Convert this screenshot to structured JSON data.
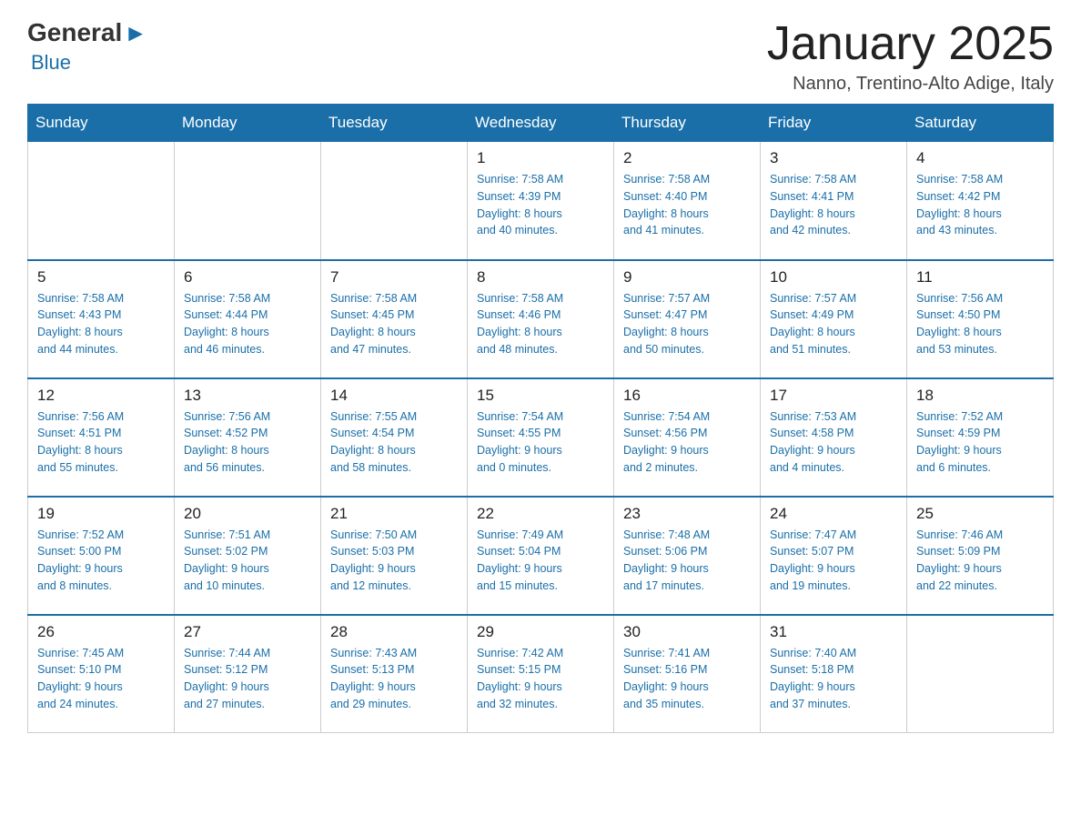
{
  "logo": {
    "general": "General",
    "blue": "Blue",
    "arrow": "▶"
  },
  "title": "January 2025",
  "location": "Nanno, Trentino-Alto Adige, Italy",
  "days_of_week": [
    "Sunday",
    "Monday",
    "Tuesday",
    "Wednesday",
    "Thursday",
    "Friday",
    "Saturday"
  ],
  "weeks": [
    [
      {
        "day": "",
        "info": ""
      },
      {
        "day": "",
        "info": ""
      },
      {
        "day": "",
        "info": ""
      },
      {
        "day": "1",
        "info": "Sunrise: 7:58 AM\nSunset: 4:39 PM\nDaylight: 8 hours\nand 40 minutes."
      },
      {
        "day": "2",
        "info": "Sunrise: 7:58 AM\nSunset: 4:40 PM\nDaylight: 8 hours\nand 41 minutes."
      },
      {
        "day": "3",
        "info": "Sunrise: 7:58 AM\nSunset: 4:41 PM\nDaylight: 8 hours\nand 42 minutes."
      },
      {
        "day": "4",
        "info": "Sunrise: 7:58 AM\nSunset: 4:42 PM\nDaylight: 8 hours\nand 43 minutes."
      }
    ],
    [
      {
        "day": "5",
        "info": "Sunrise: 7:58 AM\nSunset: 4:43 PM\nDaylight: 8 hours\nand 44 minutes."
      },
      {
        "day": "6",
        "info": "Sunrise: 7:58 AM\nSunset: 4:44 PM\nDaylight: 8 hours\nand 46 minutes."
      },
      {
        "day": "7",
        "info": "Sunrise: 7:58 AM\nSunset: 4:45 PM\nDaylight: 8 hours\nand 47 minutes."
      },
      {
        "day": "8",
        "info": "Sunrise: 7:58 AM\nSunset: 4:46 PM\nDaylight: 8 hours\nand 48 minutes."
      },
      {
        "day": "9",
        "info": "Sunrise: 7:57 AM\nSunset: 4:47 PM\nDaylight: 8 hours\nand 50 minutes."
      },
      {
        "day": "10",
        "info": "Sunrise: 7:57 AM\nSunset: 4:49 PM\nDaylight: 8 hours\nand 51 minutes."
      },
      {
        "day": "11",
        "info": "Sunrise: 7:56 AM\nSunset: 4:50 PM\nDaylight: 8 hours\nand 53 minutes."
      }
    ],
    [
      {
        "day": "12",
        "info": "Sunrise: 7:56 AM\nSunset: 4:51 PM\nDaylight: 8 hours\nand 55 minutes."
      },
      {
        "day": "13",
        "info": "Sunrise: 7:56 AM\nSunset: 4:52 PM\nDaylight: 8 hours\nand 56 minutes."
      },
      {
        "day": "14",
        "info": "Sunrise: 7:55 AM\nSunset: 4:54 PM\nDaylight: 8 hours\nand 58 minutes."
      },
      {
        "day": "15",
        "info": "Sunrise: 7:54 AM\nSunset: 4:55 PM\nDaylight: 9 hours\nand 0 minutes."
      },
      {
        "day": "16",
        "info": "Sunrise: 7:54 AM\nSunset: 4:56 PM\nDaylight: 9 hours\nand 2 minutes."
      },
      {
        "day": "17",
        "info": "Sunrise: 7:53 AM\nSunset: 4:58 PM\nDaylight: 9 hours\nand 4 minutes."
      },
      {
        "day": "18",
        "info": "Sunrise: 7:52 AM\nSunset: 4:59 PM\nDaylight: 9 hours\nand 6 minutes."
      }
    ],
    [
      {
        "day": "19",
        "info": "Sunrise: 7:52 AM\nSunset: 5:00 PM\nDaylight: 9 hours\nand 8 minutes."
      },
      {
        "day": "20",
        "info": "Sunrise: 7:51 AM\nSunset: 5:02 PM\nDaylight: 9 hours\nand 10 minutes."
      },
      {
        "day": "21",
        "info": "Sunrise: 7:50 AM\nSunset: 5:03 PM\nDaylight: 9 hours\nand 12 minutes."
      },
      {
        "day": "22",
        "info": "Sunrise: 7:49 AM\nSunset: 5:04 PM\nDaylight: 9 hours\nand 15 minutes."
      },
      {
        "day": "23",
        "info": "Sunrise: 7:48 AM\nSunset: 5:06 PM\nDaylight: 9 hours\nand 17 minutes."
      },
      {
        "day": "24",
        "info": "Sunrise: 7:47 AM\nSunset: 5:07 PM\nDaylight: 9 hours\nand 19 minutes."
      },
      {
        "day": "25",
        "info": "Sunrise: 7:46 AM\nSunset: 5:09 PM\nDaylight: 9 hours\nand 22 minutes."
      }
    ],
    [
      {
        "day": "26",
        "info": "Sunrise: 7:45 AM\nSunset: 5:10 PM\nDaylight: 9 hours\nand 24 minutes."
      },
      {
        "day": "27",
        "info": "Sunrise: 7:44 AM\nSunset: 5:12 PM\nDaylight: 9 hours\nand 27 minutes."
      },
      {
        "day": "28",
        "info": "Sunrise: 7:43 AM\nSunset: 5:13 PM\nDaylight: 9 hours\nand 29 minutes."
      },
      {
        "day": "29",
        "info": "Sunrise: 7:42 AM\nSunset: 5:15 PM\nDaylight: 9 hours\nand 32 minutes."
      },
      {
        "day": "30",
        "info": "Sunrise: 7:41 AM\nSunset: 5:16 PM\nDaylight: 9 hours\nand 35 minutes."
      },
      {
        "day": "31",
        "info": "Sunrise: 7:40 AM\nSunset: 5:18 PM\nDaylight: 9 hours\nand 37 minutes."
      },
      {
        "day": "",
        "info": ""
      }
    ]
  ]
}
